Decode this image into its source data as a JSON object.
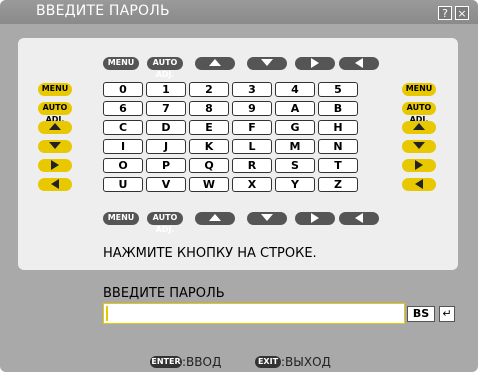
{
  "window": {
    "title": "ВВЕДИТЕ ПАРОЛЬ",
    "help_label": "?",
    "close_label": "×"
  },
  "keyboard": {
    "top_buttons": [
      "MENU",
      "AUTO ADJ.",
      "up",
      "down",
      "right",
      "left"
    ],
    "bottom_buttons": [
      "MENU",
      "AUTO ADJ.",
      "up",
      "down",
      "right",
      "left"
    ],
    "side_buttons": [
      "MENU",
      "AUTO ADJ.",
      "up",
      "down",
      "right",
      "left"
    ],
    "rows": [
      [
        "0",
        "1",
        "2",
        "3",
        "4",
        "5"
      ],
      [
        "6",
        "7",
        "8",
        "9",
        "A",
        "B"
      ],
      [
        "C",
        "D",
        "E",
        "F",
        "G",
        "H"
      ],
      [
        "I",
        "J",
        "K",
        "L",
        "M",
        "N"
      ],
      [
        "O",
        "P",
        "Q",
        "R",
        "S",
        "T"
      ],
      [
        "U",
        "V",
        "W",
        "X",
        "Y",
        "Z"
      ]
    ]
  },
  "instruction": "НАЖМИТЕ КНОПКУ НА СТРОКЕ.",
  "password": {
    "label": "ВВЕДИТЕ ПАРОЛЬ",
    "value": "",
    "bs_label": "BS",
    "enter_symbol": "↵"
  },
  "footer": {
    "enter_key": "ENTER",
    "enter_text": ":ВВОД",
    "exit_key": "EXIT",
    "exit_text": ":ВЫХОД"
  },
  "colors": {
    "accent": "#e8c800",
    "frame": "#a9a9a9",
    "panel": "#eeeeee"
  }
}
